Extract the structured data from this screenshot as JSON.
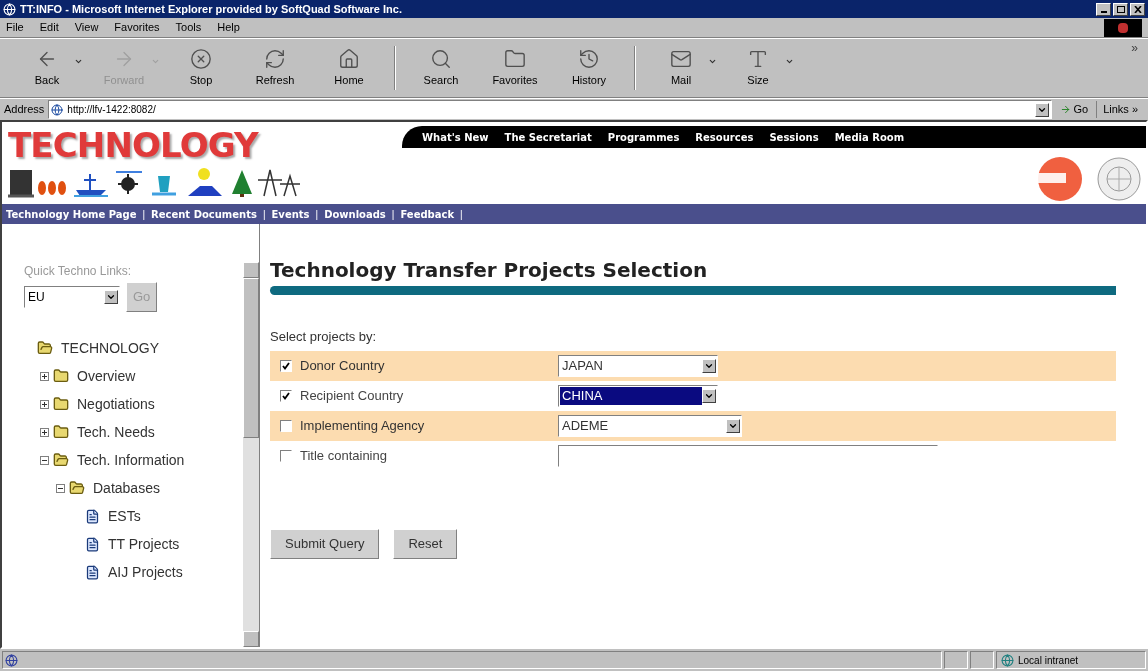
{
  "window": {
    "title": "TT:INFO - Microsoft Internet Explorer provided by SoftQuad Software Inc."
  },
  "menu": [
    "File",
    "Edit",
    "View",
    "Favorites",
    "Tools",
    "Help"
  ],
  "toolbar": [
    {
      "kind": "back",
      "label": "Back",
      "disabled": false,
      "dropdown": true
    },
    {
      "kind": "forward",
      "label": "Forward",
      "disabled": true,
      "dropdown": true
    },
    {
      "kind": "stop",
      "label": "Stop",
      "disabled": false,
      "dropdown": false
    },
    {
      "kind": "refresh",
      "label": "Refresh",
      "disabled": false,
      "dropdown": false
    },
    {
      "kind": "home",
      "label": "Home",
      "disabled": false,
      "dropdown": false
    },
    {
      "kind": "search",
      "label": "Search",
      "disabled": false,
      "dropdown": false
    },
    {
      "kind": "favorites",
      "label": "Favorites",
      "disabled": false,
      "dropdown": false
    },
    {
      "kind": "history",
      "label": "History",
      "disabled": false,
      "dropdown": false
    },
    {
      "kind": "mail",
      "label": "Mail",
      "disabled": false,
      "dropdown": true
    },
    {
      "kind": "size",
      "label": "Size",
      "disabled": false,
      "dropdown": true
    }
  ],
  "toolbar_more": "»",
  "address": {
    "label": "Address",
    "url": "http://lfv-1422:8082/",
    "go": "Go",
    "links": "Links »"
  },
  "header": {
    "logo": "TECHNOLOGY",
    "top_nav": [
      "What's New",
      "The Secretariat",
      "Programmes",
      "Resources",
      "Sessions",
      "Media Room"
    ],
    "sub_nav": [
      "Technology Home Page",
      "Recent Documents",
      "Events",
      "Downloads",
      "Feedback"
    ],
    "separator": "|"
  },
  "sidebar": {
    "label": "Quick Techno Links:",
    "select": "EU",
    "go": "Go",
    "tree": [
      {
        "kind": "folder",
        "label": "TECHNOLOGY",
        "expanded": true,
        "children": [
          {
            "kind": "folder",
            "label": "Overview",
            "expanded": false
          },
          {
            "kind": "folder",
            "label": "Negotiations",
            "expanded": false
          },
          {
            "kind": "folder",
            "label": "Tech. Needs",
            "expanded": false
          },
          {
            "kind": "folder",
            "label": "Tech. Information",
            "expanded": true,
            "children": [
              {
                "kind": "folder",
                "label": "Databases",
                "expanded": true,
                "children": [
                  {
                    "kind": "document",
                    "label": "ESTs"
                  },
                  {
                    "kind": "document",
                    "label": "TT Projects"
                  },
                  {
                    "kind": "document",
                    "label": "AIJ Projects"
                  }
                ]
              }
            ]
          }
        ]
      }
    ]
  },
  "main": {
    "title": "Technology Transfer Projects Selection",
    "prompt": "Select projects by:",
    "rows": [
      {
        "kind": "select",
        "label": "Donor Country",
        "checked": true,
        "shaded": true,
        "value": "JAPAN",
        "focused": false
      },
      {
        "kind": "select",
        "label": "Recipient Country",
        "checked": true,
        "shaded": false,
        "value": "CHINA",
        "focused": true
      },
      {
        "kind": "select",
        "label": "Implementing Agency",
        "checked": false,
        "shaded": true,
        "value": "ADEME",
        "focused": false
      },
      {
        "kind": "text",
        "label": "Title containing",
        "checked": false,
        "shaded": false,
        "value": ""
      }
    ],
    "buttons": [
      "Submit Query",
      "Reset"
    ]
  },
  "status_bar": {
    "zone": "Local intranet"
  }
}
